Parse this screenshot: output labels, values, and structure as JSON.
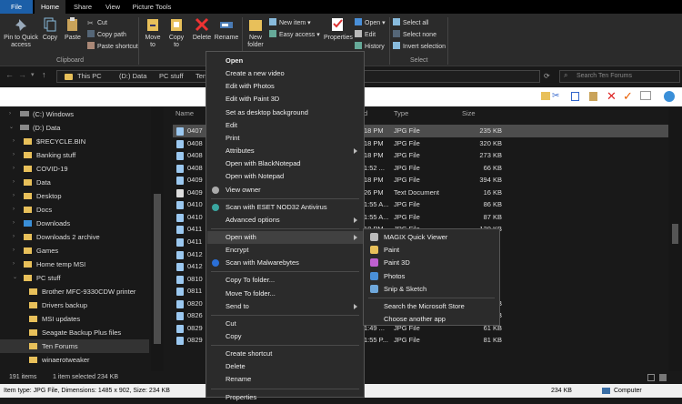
{
  "tabs": {
    "file": "File",
    "home": "Home",
    "share": "Share",
    "view": "View",
    "picture_tools": "Picture Tools"
  },
  "ribbon": {
    "clipboard": {
      "pin": "Pin to Quick access",
      "copy": "Copy",
      "paste": "Paste",
      "cut": "Cut",
      "copy_path": "Copy path",
      "paste_shortcut": "Paste shortcut",
      "group": "Clipboard"
    },
    "organize": {
      "move_to": "Move to",
      "copy_to": "Copy to",
      "delete": "Delete",
      "rename": "Rename",
      "group": "Organize"
    },
    "new": {
      "new_folder": "New folder",
      "new_item": "New item",
      "easy_access": "Easy access"
    },
    "open": {
      "properties": "Properties",
      "open": "Open",
      "edit": "Edit",
      "history": "History"
    },
    "select": {
      "select_all": "Select all",
      "select_none": "Select none",
      "invert": "Invert selection",
      "group": "Select"
    }
  },
  "address": {
    "crumbs": [
      "This PC",
      "(D:) Data",
      "PC stuff",
      "Ten"
    ],
    "search_placeholder": "Search Ten Forums"
  },
  "nav": [
    {
      "label": "(C:) Windows",
      "indent": 1,
      "type": "drive"
    },
    {
      "label": "(D:) Data",
      "indent": 1,
      "type": "drive"
    },
    {
      "label": "$RECYCLE.BIN",
      "indent": 2,
      "type": "folder"
    },
    {
      "label": "Banking stuff",
      "indent": 2,
      "type": "folder"
    },
    {
      "label": "COVID-19",
      "indent": 2,
      "type": "folder"
    },
    {
      "label": "Data",
      "indent": 2,
      "type": "folder"
    },
    {
      "label": "Desktop",
      "indent": 2,
      "type": "folder"
    },
    {
      "label": "Docs",
      "indent": 2,
      "type": "folder"
    },
    {
      "label": "Downloads",
      "indent": 2,
      "type": "download"
    },
    {
      "label": "Downloads 2 archive",
      "indent": 2,
      "type": "folder"
    },
    {
      "label": "Games",
      "indent": 2,
      "type": "folder"
    },
    {
      "label": "Home temp MSI",
      "indent": 2,
      "type": "folder"
    },
    {
      "label": "PC stuff",
      "indent": 2,
      "type": "folder"
    },
    {
      "label": "Brother MFC-9330CDW printer",
      "indent": 3,
      "type": "folder"
    },
    {
      "label": "Drivers backup",
      "indent": 3,
      "type": "folder"
    },
    {
      "label": "MSI updates",
      "indent": 3,
      "type": "folder"
    },
    {
      "label": "Seagate Backup Plus files",
      "indent": 3,
      "type": "folder"
    },
    {
      "label": "Ten Forums",
      "indent": 3,
      "type": "folder",
      "selected": true
    },
    {
      "label": "winaerotweaker",
      "indent": 3,
      "type": "folder"
    }
  ],
  "columns": {
    "name": "Name",
    "date": "d",
    "type": "Type",
    "size": "Size"
  },
  "files": [
    {
      "name": "0407",
      "time": "18 PM",
      "type": "JPG File",
      "size": "235 KB",
      "selected": true
    },
    {
      "name": "0408",
      "time": "18 PM",
      "type": "JPG File",
      "size": "320 KB"
    },
    {
      "name": "0408",
      "time": "18 PM",
      "type": "JPG File",
      "size": "273 KB"
    },
    {
      "name": "0408",
      "time": "1:52 ...",
      "type": "JPG File",
      "size": "66 KB"
    },
    {
      "name": "0409",
      "time": "18 PM",
      "type": "JPG File",
      "size": "394 KB"
    },
    {
      "name": "0409",
      "time": "26 PM",
      "type": "Text Document",
      "size": "16 KB"
    },
    {
      "name": "0410",
      "time": "1:55 A...",
      "type": "JPG File",
      "size": "86 KB"
    },
    {
      "name": "0410",
      "time": "1:55 A...",
      "type": "JPG File",
      "size": "87 KB"
    },
    {
      "name": "0411",
      "time": "18 PM",
      "type": "JPG File",
      "size": "120 KB"
    },
    {
      "name": "0411",
      "time": "18 PM",
      "type": "JPG File",
      "size": ""
    },
    {
      "name": "0412",
      "time": "",
      "type": "",
      "size": ""
    },
    {
      "name": "0412",
      "time": "",
      "type": "",
      "size": ""
    },
    {
      "name": "0810",
      "time": "",
      "type": "",
      "size": ""
    },
    {
      "name": "0811",
      "time": "",
      "type": "",
      "size": ""
    },
    {
      "name": "0820",
      "time": "",
      "type": "",
      "size": "32 KB"
    },
    {
      "name": "0826",
      "time": "0:11 ...",
      "type": "JPG File",
      "size": "31 KB"
    },
    {
      "name": "0829",
      "time": "1:49 ...",
      "type": "JPG File",
      "size": "61 KB"
    },
    {
      "name": "0829",
      "time": "1:55 P...",
      "type": "JPG File",
      "size": "81 KB"
    }
  ],
  "context_menu": [
    {
      "label": "Open",
      "bold": true
    },
    {
      "label": "Create a new video"
    },
    {
      "label": "Edit with Photos"
    },
    {
      "label": "Edit with Paint 3D"
    },
    {
      "label": "Set as desktop background"
    },
    {
      "label": "Edit"
    },
    {
      "label": "Print"
    },
    {
      "label": "Attributes",
      "arrow": true
    },
    {
      "label": "Open with BlackNotepad"
    },
    {
      "label": "Open with Notepad"
    },
    {
      "label": "View owner",
      "icon": "person-icon"
    },
    {
      "sep": true
    },
    {
      "label": "Scan with ESET NOD32 Antivirus",
      "icon": "eset-icon"
    },
    {
      "label": "Advanced options",
      "arrow": true
    },
    {
      "sep": true
    },
    {
      "label": "Open with",
      "arrow": true,
      "highlight": true
    },
    {
      "label": "Encrypt"
    },
    {
      "label": "Scan with Malwarebytes",
      "icon": "malwarebytes-icon"
    },
    {
      "sep": true
    },
    {
      "label": "Copy To folder..."
    },
    {
      "label": "Move To folder..."
    },
    {
      "label": "Send to",
      "arrow": true
    },
    {
      "sep": true
    },
    {
      "label": "Cut"
    },
    {
      "label": "Copy"
    },
    {
      "sep": true
    },
    {
      "label": "Create shortcut"
    },
    {
      "label": "Delete"
    },
    {
      "label": "Rename"
    },
    {
      "sep": true
    },
    {
      "label": "Properties"
    }
  ],
  "open_with_submenu": [
    {
      "label": "MAGIX Quick Viewer",
      "icon": "magix-icon",
      "color": "#bbbbbb"
    },
    {
      "label": "Paint",
      "icon": "paint-icon",
      "color": "#e8c05a"
    },
    {
      "label": "Paint 3D",
      "icon": "paint3d-icon",
      "color": "#c060d0"
    },
    {
      "label": "Photos",
      "icon": "photos-icon",
      "color": "#4a90d9"
    },
    {
      "label": "Snip & Sketch",
      "icon": "snip-icon",
      "color": "#6fa8dc"
    },
    {
      "sep": true
    },
    {
      "label": "Search the Microsoft Store"
    },
    {
      "label": "Choose another app"
    }
  ],
  "status": {
    "items": "191 items",
    "selected": "1 item selected  234 KB",
    "info": "Item type: JPG File, Dimensions: 1485 x 902, Size: 234 KB",
    "size": "234 KB",
    "location": "Computer"
  }
}
